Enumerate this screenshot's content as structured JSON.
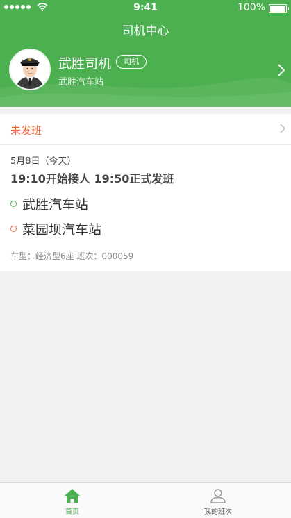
{
  "colors": {
    "primary": "#4caf50",
    "accent_orange": "#e8683a",
    "inactive_tab": "#999999"
  },
  "status_bar": {
    "time": "9:41",
    "battery": "100%"
  },
  "nav": {
    "title": "司机中心"
  },
  "profile": {
    "name": "武胜司机",
    "role_badge": "司机",
    "station": "武胜汽车站"
  },
  "trip": {
    "status": "未发班",
    "date": "5月8日（今天）",
    "schedule": "19:10开始接人 19:50正式发班",
    "stops": [
      {
        "name": "武胜汽车站",
        "dot_color": "#4caf50"
      },
      {
        "name": "菜园坝汽车站",
        "dot_color": "#e8683a"
      }
    ],
    "vehicle_info": "车型：经济型6座 班次：000059"
  },
  "tabbar": {
    "items": [
      {
        "label": "首页",
        "icon": "home-icon",
        "active": true
      },
      {
        "label": "我的班次",
        "icon": "person-icon",
        "active": false
      }
    ]
  }
}
